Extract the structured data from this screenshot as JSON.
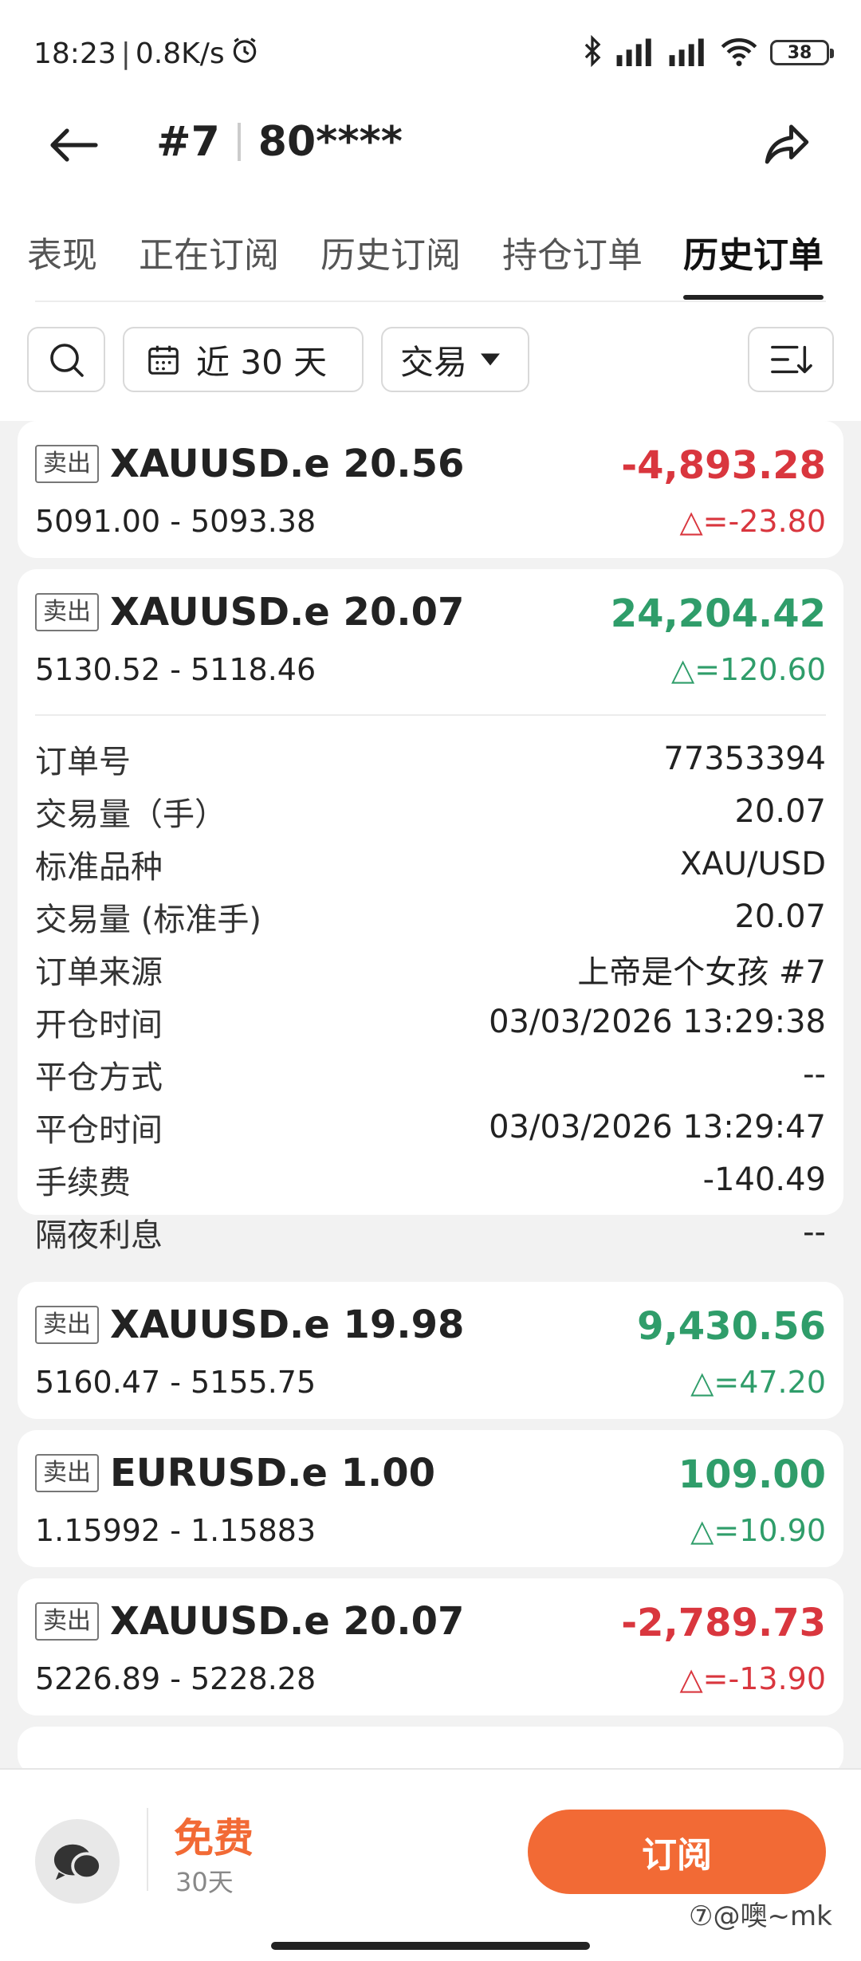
{
  "status": {
    "time": "18:23",
    "speed": "0.8K/s",
    "battery": "38"
  },
  "header": {
    "index": "#7",
    "account": "80****"
  },
  "tabs": [
    "表现",
    "正在订阅",
    "历史订阅",
    "持仓订单",
    "历史订单"
  ],
  "active_tab": 4,
  "filters": {
    "period": "近 30 天",
    "type": "交易"
  },
  "orders": [
    {
      "side": "卖出",
      "symbol": "XAUUSD.e 20.56",
      "profit": "-4,893.28",
      "prices": "5091.00 - 5093.38",
      "delta": "△=-23.80",
      "positive": false
    },
    {
      "side": "卖出",
      "symbol": "XAUUSD.e 20.07",
      "profit": "24,204.42",
      "prices": "5130.52 - 5118.46",
      "delta": "△=120.60",
      "positive": true
    },
    {
      "side": "卖出",
      "symbol": "XAUUSD.e 19.98",
      "profit": "9,430.56",
      "prices": "5160.47 - 5155.75",
      "delta": "△=47.20",
      "positive": true
    },
    {
      "side": "卖出",
      "symbol": "EURUSD.e 1.00",
      "profit": "109.00",
      "prices": "1.15992 - 1.15883",
      "delta": "△=10.90",
      "positive": true
    },
    {
      "side": "卖出",
      "symbol": "XAUUSD.e 20.07",
      "profit": "-2,789.73",
      "prices": "5226.89 - 5228.28",
      "delta": "△=-13.90",
      "positive": false
    }
  ],
  "details": [
    {
      "label": "订单号",
      "value": "77353394"
    },
    {
      "label": "交易量（手）",
      "value": "20.07"
    },
    {
      "label": "标准品种",
      "value": "XAU/USD"
    },
    {
      "label": "交易量 (标准手)",
      "value": "20.07"
    },
    {
      "label": "订单来源",
      "value": "上帝是个女孩 #7"
    },
    {
      "label": "开仓时间",
      "value": "03/03/2026 13:29:38"
    },
    {
      "label": "平仓方式",
      "value": "--"
    },
    {
      "label": "平仓时间",
      "value": "03/03/2026 13:29:47"
    },
    {
      "label": "手续费",
      "value": "-140.49"
    },
    {
      "label": "隔夜利息",
      "value": "--"
    }
  ],
  "bottom": {
    "free": "免费",
    "duration": "30天",
    "subscribe": "订阅",
    "watermark": "⑦@噢~mk"
  }
}
